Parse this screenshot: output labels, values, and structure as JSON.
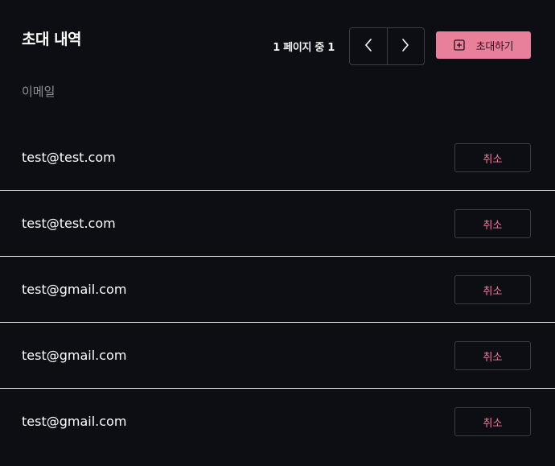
{
  "header": {
    "title": "초대 내역",
    "pager_text": "1 페이지 중 1",
    "invite_label": "초대하기"
  },
  "table": {
    "column_header": "이메일",
    "rows": [
      {
        "email": "test@test.com",
        "action": "취소"
      },
      {
        "email": "test@test.com",
        "action": "취소"
      },
      {
        "email": "test@gmail.com",
        "action": "취소"
      },
      {
        "email": "test@gmail.com",
        "action": "취소"
      },
      {
        "email": "test@gmail.com",
        "action": "취소"
      }
    ]
  },
  "icons": {
    "prev": "chevron-left-icon",
    "next": "chevron-right-icon",
    "invite": "plus-square-icon"
  },
  "colors": {
    "background": "#0c0e14",
    "accent": "#e8809c",
    "border": "#3a3d45",
    "muted_text": "#8a8f98",
    "divider": "#e6e6e6"
  }
}
